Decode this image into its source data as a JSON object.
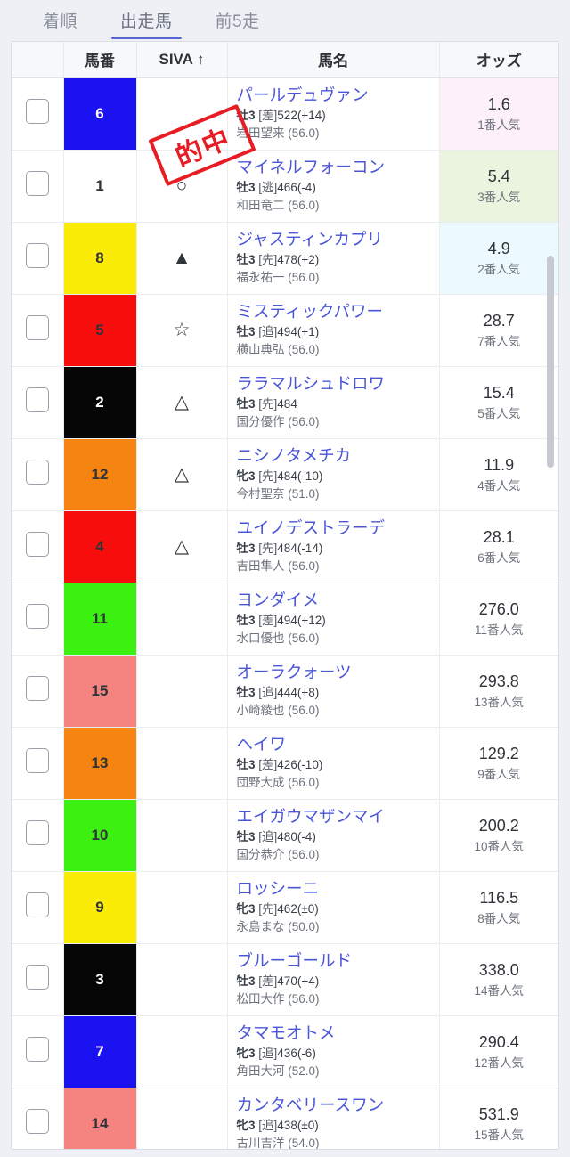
{
  "tabs": [
    {
      "label": "着順",
      "active": false
    },
    {
      "label": "出走馬",
      "active": true
    },
    {
      "label": "前5走",
      "active": false
    }
  ],
  "stamp": {
    "text": "的中",
    "color": "#e81c24"
  },
  "table": {
    "headers": {
      "checkbox": "",
      "number": "馬番",
      "siva": "SIVA ↑",
      "name": "馬名",
      "odds": "オッズ"
    },
    "sort": {
      "column": "SIVA",
      "direction": "asc",
      "indicator": "↑"
    },
    "frame_colors": {
      "blue": "#1a12f0",
      "white": "#ffffff",
      "yellow": "#fbec07",
      "red": "#f80d0d",
      "black": "#050505",
      "orange": "#f58410",
      "green": "#3cf112",
      "pink": "#f5837f"
    },
    "rows": [
      {
        "number": "6",
        "frame_color": "#1a12f0",
        "number_text_color": "#ffffff",
        "siva": "",
        "name": "パールデュヴァン",
        "sex_age": "牡3",
        "style": "[差]",
        "weight": "522(+14)",
        "jockey": "岩田望来 (56.0)",
        "odds": "1.6",
        "popularity": "1番人気",
        "odds_bg": "#fdf0fa"
      },
      {
        "number": "1",
        "frame_color": "#ffffff",
        "number_text_color": "#2f3338",
        "siva": "○",
        "name": "マイネルフォーコン",
        "sex_age": "牡3",
        "style": "[逃]",
        "weight": "466(-4)",
        "jockey": "和田竜二 (56.0)",
        "odds": "5.4",
        "popularity": "3番人気",
        "odds_bg": "#eaf4de"
      },
      {
        "number": "8",
        "frame_color": "#fbec07",
        "number_text_color": "#2f3338",
        "siva": "▲",
        "name": "ジャスティンカプリ",
        "sex_age": "牡3",
        "style": "[先]",
        "weight": "478(+2)",
        "jockey": "福永祐一 (56.0)",
        "odds": "4.9",
        "popularity": "2番人気",
        "odds_bg": "#edfafd"
      },
      {
        "number": "5",
        "frame_color": "#f80d0d",
        "number_text_color": "#2f3338",
        "siva": "☆",
        "name": "ミスティックパワー",
        "sex_age": "牡3",
        "style": "[追]",
        "weight": "494(+1)",
        "jockey": "横山典弘 (56.0)",
        "odds": "28.7",
        "popularity": "7番人気",
        "odds_bg": "#ffffff"
      },
      {
        "number": "2",
        "frame_color": "#050505",
        "number_text_color": "#ffffff",
        "siva": "△",
        "name": "ララマルシュドロワ",
        "sex_age": "牡3",
        "style": "[先]",
        "weight": "484",
        "jockey": "国分優作 (56.0)",
        "odds": "15.4",
        "popularity": "5番人気",
        "odds_bg": "#ffffff"
      },
      {
        "number": "12",
        "frame_color": "#f58410",
        "number_text_color": "#2f3338",
        "siva": "△",
        "name": "ニシノタメチカ",
        "sex_age": "牝3",
        "style": "[先]",
        "weight": "484(-10)",
        "jockey": "今村聖奈 (51.0)",
        "odds": "11.9",
        "popularity": "4番人気",
        "odds_bg": "#ffffff"
      },
      {
        "number": "4",
        "frame_color": "#f80d0d",
        "number_text_color": "#2f3338",
        "siva": "△",
        "name": "ユイノデストラーデ",
        "sex_age": "牡3",
        "style": "[先]",
        "weight": "484(-14)",
        "jockey": "吉田隼人 (56.0)",
        "odds": "28.1",
        "popularity": "6番人気",
        "odds_bg": "#ffffff"
      },
      {
        "number": "11",
        "frame_color": "#3cf112",
        "number_text_color": "#2f3338",
        "siva": "",
        "name": "ヨンダイメ",
        "sex_age": "牡3",
        "style": "[差]",
        "weight": "494(+12)",
        "jockey": "水口優也 (56.0)",
        "odds": "276.0",
        "popularity": "11番人気",
        "odds_bg": "#ffffff"
      },
      {
        "number": "15",
        "frame_color": "#f5837f",
        "number_text_color": "#2f3338",
        "siva": "",
        "name": "オーラクォーツ",
        "sex_age": "牡3",
        "style": "[追]",
        "weight": "444(+8)",
        "jockey": "小崎綾也 (56.0)",
        "odds": "293.8",
        "popularity": "13番人気",
        "odds_bg": "#ffffff"
      },
      {
        "number": "13",
        "frame_color": "#f58410",
        "number_text_color": "#2f3338",
        "siva": "",
        "name": "ヘイワ",
        "sex_age": "牡3",
        "style": "[差]",
        "weight": "426(-10)",
        "jockey": "団野大成 (56.0)",
        "odds": "129.2",
        "popularity": "9番人気",
        "odds_bg": "#ffffff"
      },
      {
        "number": "10",
        "frame_color": "#3cf112",
        "number_text_color": "#2f3338",
        "siva": "",
        "name": "エイガウマザンマイ",
        "sex_age": "牡3",
        "style": "[追]",
        "weight": "480(-4)",
        "jockey": "国分恭介 (56.0)",
        "odds": "200.2",
        "popularity": "10番人気",
        "odds_bg": "#ffffff"
      },
      {
        "number": "9",
        "frame_color": "#fbec07",
        "number_text_color": "#2f3338",
        "siva": "",
        "name": "ロッシーニ",
        "sex_age": "牝3",
        "style": "[先]",
        "weight": "462(±0)",
        "jockey": "永島まな (50.0)",
        "odds": "116.5",
        "popularity": "8番人気",
        "odds_bg": "#ffffff"
      },
      {
        "number": "3",
        "frame_color": "#050505",
        "number_text_color": "#ffffff",
        "siva": "",
        "name": "ブルーゴールド",
        "sex_age": "牡3",
        "style": "[差]",
        "weight": "470(+4)",
        "jockey": "松田大作 (56.0)",
        "odds": "338.0",
        "popularity": "14番人気",
        "odds_bg": "#ffffff"
      },
      {
        "number": "7",
        "frame_color": "#1a12f0",
        "number_text_color": "#ffffff",
        "siva": "",
        "name": "タマモオトメ",
        "sex_age": "牝3",
        "style": "[追]",
        "weight": "436(-6)",
        "jockey": "角田大河 (52.0)",
        "odds": "290.4",
        "popularity": "12番人気",
        "odds_bg": "#ffffff"
      },
      {
        "number": "14",
        "frame_color": "#f5837f",
        "number_text_color": "#2f3338",
        "siva": "",
        "name": "カンタベリースワン",
        "sex_age": "牝3",
        "style": "[追]",
        "weight": "438(±0)",
        "jockey": "古川吉洋 (54.0)",
        "odds": "531.9",
        "popularity": "15番人気",
        "odds_bg": "#ffffff"
      }
    ]
  }
}
